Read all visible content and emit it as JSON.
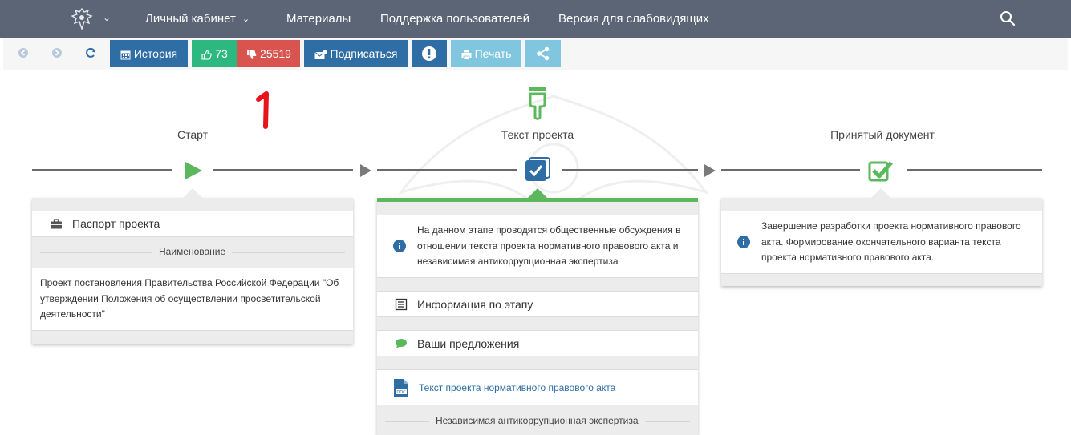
{
  "nav": {
    "items": [
      {
        "label": "Личный кабинет",
        "has_caret": true
      },
      {
        "label": "Материалы"
      },
      {
        "label": "Поддержка пользователей"
      },
      {
        "label": "Версия для слабовидящих"
      }
    ],
    "background": "#5b6576"
  },
  "toolbar": {
    "history_label": "История",
    "likes": "73",
    "dislikes": "25519",
    "subscribe_label": "Подписаться",
    "print_label": "Печать"
  },
  "annotation": "1",
  "stages": [
    {
      "title": "Старт",
      "icon": "play-icon"
    },
    {
      "title": "Текст проекта",
      "icon": "checkbox-doc-icon"
    },
    {
      "title": "Принятый документ",
      "icon": "check-square-icon"
    }
  ],
  "card_start": {
    "passport_label": "Паспорт проекта",
    "name_header": "Наименование",
    "name_text": "Проект постановления Правительства Российской Федерации \"Об утверждении Положения об осуществлении просветительской деятельности\""
  },
  "card_text": {
    "info_text": "На данном этапе проводятся общественные обсуждения в отношении текста проекта нормативного правового акта и независимая антикоррупционная экспертиза",
    "stage_info_label": "Информация по этапу",
    "proposals_label": "Ваши предложения",
    "doc_link": "Текст проекта нормативного правового акта",
    "expertise_header": "Независимая антикоррупционная экспертиза"
  },
  "card_final": {
    "info_text": "Завершение разработки проекта нормативного правового акта. Формирование окончательного варианта текста проекта нормативного правового акта."
  },
  "colors": {
    "accent_blue": "#2f6da5",
    "green": "#5cb85c",
    "like_green": "#2db87f",
    "dislike_red": "#d9534f",
    "print_blue": "#7fc6de"
  }
}
